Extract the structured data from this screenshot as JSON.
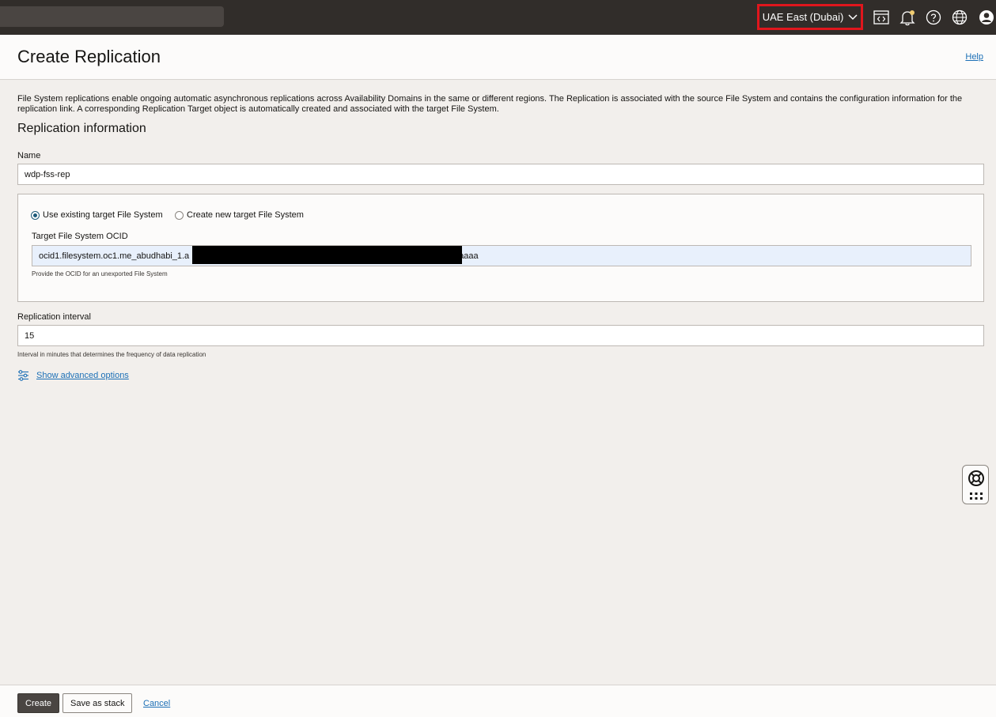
{
  "topbar": {
    "region": "UAE East (Dubai)",
    "icons": [
      "code-editor-icon",
      "bell-icon",
      "help-circle-icon",
      "globe-icon",
      "user-avatar-icon"
    ],
    "notification_color": "#f0cc71"
  },
  "header": {
    "title": "Create Replication",
    "help": "Help"
  },
  "description": "File System replications enable ongoing automatic asynchronous replications across Availability Domains in the same or different regions. The Replication is associated with the source File System and contains the configuration information for the replication link. A corresponding Replication Target object is automatically created and associated with the target File System.",
  "section_title": "Replication information",
  "name_field": {
    "label": "Name",
    "value": "wdp-fss-rep"
  },
  "target": {
    "option_existing": "Use existing target File System",
    "option_new": "Create new target File System",
    "selected": "existing",
    "ocid_label": "Target File System OCID",
    "ocid_prefix": "ocid1.filesystem.oc1.me_abudhabi_1.a",
    "ocid_suffix": "aaaa",
    "ocid_hint": "Provide the OCID for an unexported File System"
  },
  "interval": {
    "label": "Replication interval",
    "value": "15",
    "hint": "Interval in minutes that determines the frequency of data replication"
  },
  "advanced": "Show advanced options",
  "footer": {
    "create": "Create",
    "save_stack": "Save as stack",
    "cancel": "Cancel"
  },
  "colors": {
    "topbar": "#312d2a",
    "highlight": "#e0161d",
    "link": "#1b6fb6",
    "primary_button": "#4a4542"
  }
}
